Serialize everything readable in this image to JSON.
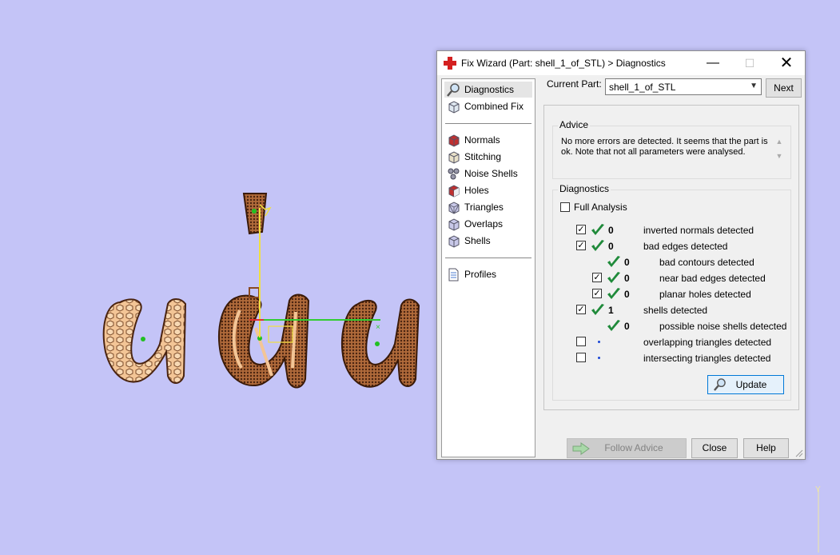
{
  "dialog": {
    "title": "Fix Wizard (Part: shell_1_of_STL) > Diagnostics",
    "controls": {
      "minimize": "—",
      "maximize": "☐",
      "close": "✕"
    }
  },
  "sidebar": {
    "items": [
      {
        "label": "Diagnostics",
        "icon": "magnifier-icon",
        "selected": true
      },
      {
        "label": "Combined Fix",
        "icon": "cube-icon"
      },
      {
        "label": "Normals",
        "icon": "normals-cube-icon"
      },
      {
        "label": "Stitching",
        "icon": "stitching-cube-icon"
      },
      {
        "label": "Noise Shells",
        "icon": "noise-shells-icon"
      },
      {
        "label": "Holes",
        "icon": "holes-cube-icon"
      },
      {
        "label": "Triangles",
        "icon": "triangles-cube-icon"
      },
      {
        "label": "Overlaps",
        "icon": "overlaps-cube-icon"
      },
      {
        "label": "Shells",
        "icon": "shells-cube-icon"
      },
      {
        "label": "Profiles",
        "icon": "document-icon"
      }
    ]
  },
  "current_part": {
    "label": "Current Part:",
    "value": "shell_1_of_STL",
    "next_label": "Next"
  },
  "advice": {
    "title": "Advice",
    "text": "No more errors are detected. It seems that the part is ok. Note that not all parameters were analysed."
  },
  "diagnostics": {
    "title": "Diagnostics",
    "full_analysis": {
      "label": "Full Analysis",
      "checked": false
    },
    "rows": [
      {
        "checkbox": true,
        "checked": true,
        "status": "ok",
        "count": "0",
        "label": "inverted normals detected",
        "indent": 0
      },
      {
        "checkbox": true,
        "checked": true,
        "status": "ok",
        "count": "0",
        "label": "bad edges detected",
        "indent": 0
      },
      {
        "checkbox": false,
        "checked": false,
        "status": "ok",
        "count": "0",
        "label": "bad contours detected",
        "indent": 1
      },
      {
        "checkbox": true,
        "checked": true,
        "status": "ok",
        "count": "0",
        "label": "near bad edges detected",
        "indent": 1
      },
      {
        "checkbox": true,
        "checked": true,
        "status": "ok",
        "count": "0",
        "label": "planar holes detected",
        "indent": 1
      },
      {
        "checkbox": true,
        "checked": true,
        "status": "ok",
        "count": "1",
        "label": "shells detected",
        "indent": 0
      },
      {
        "checkbox": false,
        "checked": false,
        "status": "ok",
        "count": "0",
        "label": "possible noise shells detected",
        "indent": 1
      },
      {
        "checkbox": true,
        "checked": false,
        "status": "pending",
        "count": "",
        "label": "overlapping triangles detected",
        "indent": 0
      },
      {
        "checkbox": true,
        "checked": false,
        "status": "pending",
        "count": "",
        "label": "intersecting triangles detected",
        "indent": 0
      }
    ],
    "update_label": "Update"
  },
  "footer": {
    "follow_advice": "Follow Advice",
    "close": "Close",
    "help": "Help"
  },
  "colors": {
    "viewport_bg": "#c4c4f7",
    "model_fill": "#e8a96a",
    "model_dark": "#8a4a22",
    "check_green": "#1f8a3a",
    "axis_green": "#33cc33",
    "axis_yellow": "#f0e040"
  }
}
